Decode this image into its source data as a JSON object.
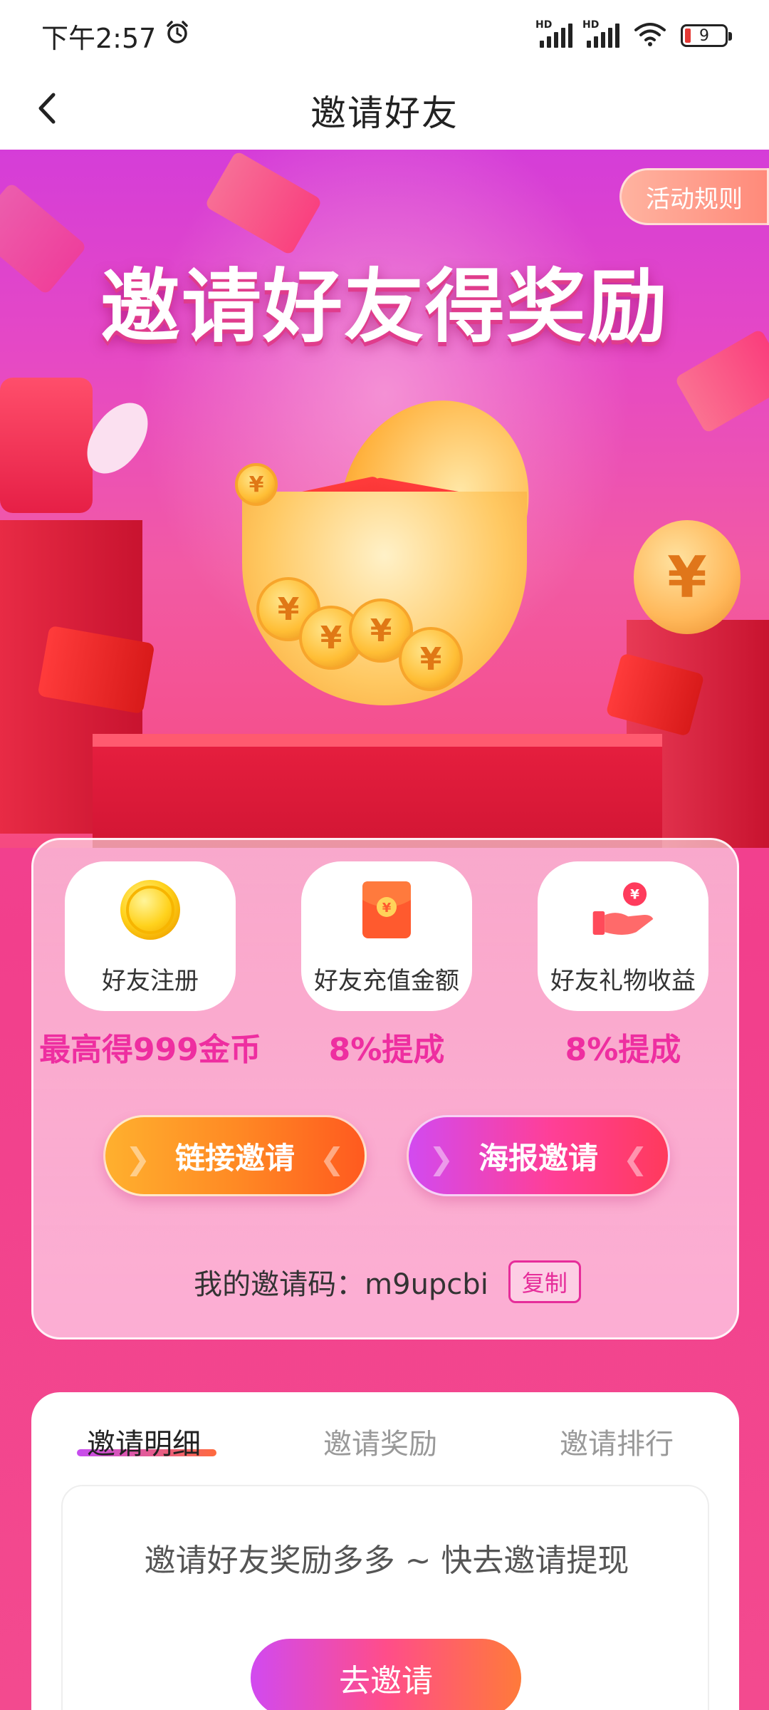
{
  "status_bar": {
    "time": "下午2:57",
    "network1": "HD",
    "network2": "HD",
    "battery": "9"
  },
  "nav": {
    "title": "邀请好友"
  },
  "hero": {
    "rules_label": "活动规则",
    "title": "邀请好友得奖励",
    "currency_symbol": "¥"
  },
  "rewards": [
    {
      "label": "好友注册",
      "value": "最高得999金币",
      "icon": "gold-coin-icon"
    },
    {
      "label": "好友充值金额",
      "value": "8%提成",
      "icon": "red-envelope-icon"
    },
    {
      "label": "好友礼物收益",
      "value": "8%提成",
      "icon": "hand-coin-icon"
    }
  ],
  "buttons": {
    "link_invite": "链接邀请",
    "poster_invite": "海报邀请"
  },
  "invite_code": {
    "text": "我的邀请码：m9upcbi",
    "copy_label": "复制"
  },
  "tabs": [
    {
      "label": "邀请明细",
      "active": true
    },
    {
      "label": "邀请奖励",
      "active": false
    },
    {
      "label": "邀请排行",
      "active": false
    }
  ],
  "detail": {
    "empty_text": "邀请好友奖励多多 ~ 快去邀请提现",
    "go_invite_label": "去邀请"
  },
  "colors": {
    "accent_pink": "#ee2ea0",
    "background": "#f23f8c"
  }
}
